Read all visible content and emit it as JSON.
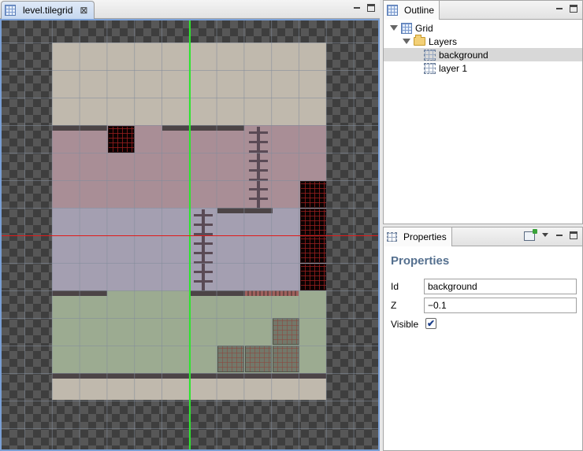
{
  "editor": {
    "tab_label": "level.tilegrid",
    "tab_icon": "tilegrid-icon",
    "close_icon": "close-icon"
  },
  "outline": {
    "tab_label": "Outline",
    "tree": [
      {
        "label": "Grid",
        "icon": "grid-icon",
        "expanded": true
      },
      {
        "label": "Layers",
        "icon": "folder-icon",
        "expanded": true
      },
      {
        "label": "background",
        "icon": "layer-icon",
        "selected": true
      },
      {
        "label": "layer 1",
        "icon": "layer-icon",
        "selected": false
      }
    ]
  },
  "properties": {
    "tab_label": "Properties",
    "heading": "Properties",
    "fields": {
      "id_label": "Id",
      "id_value": "background",
      "z_label": "Z",
      "z_value": "−0.1",
      "visible_label": "Visible",
      "visible_checked": true,
      "check_glyph": "✔"
    }
  },
  "colors": {
    "axis_x": "#e01a1a",
    "axis_y": "#2ee52e",
    "selection": "#d8d8d8",
    "heading": "#55708f"
  }
}
